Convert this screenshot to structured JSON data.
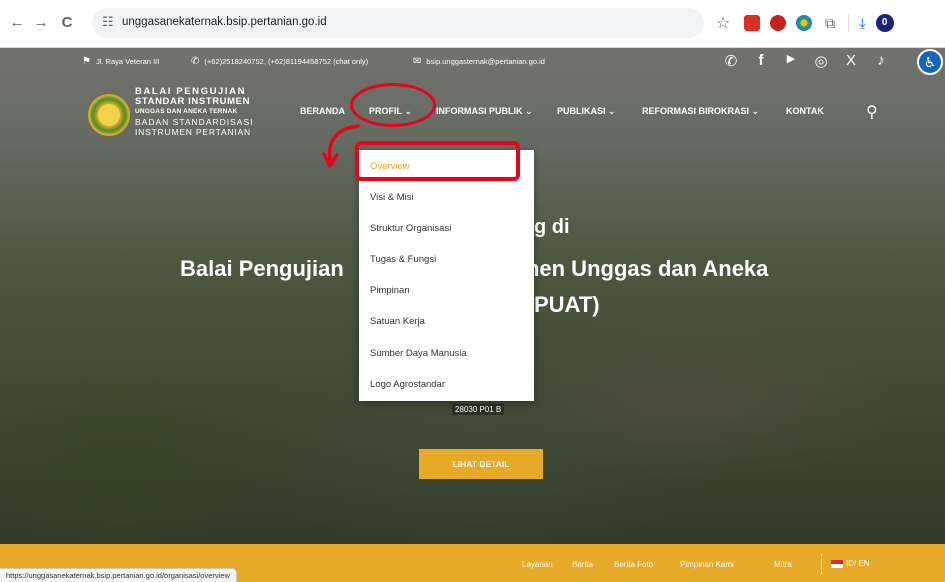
{
  "browser": {
    "url": "unggasanekaternak.bsip.pertanian.go.id",
    "back_icon": "←",
    "forward_icon": "→",
    "reload_icon": "C",
    "site_settings_icon": "☷",
    "star_icon": "☆",
    "puzzle_icon": "⧉",
    "download_icon": "⤓",
    "profile_initial": "0"
  },
  "topbar": {
    "address": "Jl. Raya Veteran III",
    "phone": "(+62)2518240752, (+62)81194458752 (chat only)",
    "email": "bsip.unggasternak@pertanian.go.id",
    "social_icons": [
      "whatsapp-icon",
      "facebook-icon",
      "youtube-icon",
      "instagram-icon",
      "x-icon",
      "tiktok-icon"
    ],
    "social_glyphs": [
      "✆",
      "f",
      "▶",
      "◎",
      "X",
      "♪"
    ]
  },
  "logo": {
    "line1": "BALAI PENGUJIAN",
    "line2": "STANDAR INSTRUMEN",
    "line3": "UNGGAS DAN ANEKA TERNAK",
    "line4": "BADAN STANDARDISASI",
    "line5": "INSTRUMEN PERTANIAN"
  },
  "nav": {
    "items": [
      {
        "label": "BERANDA"
      },
      {
        "label": "PROFIL ⌄"
      },
      {
        "label": "INFORMASI PUBLIK ⌄"
      },
      {
        "label": "PUBLIKASI ⌄"
      },
      {
        "label": "REFORMASI BIROKRASI ⌄"
      },
      {
        "label": "KONTAK"
      }
    ],
    "search_glyph": "⚲"
  },
  "profil_dropdown": {
    "items": [
      {
        "label": "Overview",
        "active": true
      },
      {
        "label": "Visi & Misi"
      },
      {
        "label": "Struktur Organisasi"
      },
      {
        "label": "Tugas & Fungsi"
      },
      {
        "label": "Pimpinan"
      },
      {
        "label": "Satuan Kerja"
      },
      {
        "label": "Sumber Daya Manusia"
      },
      {
        "label": "Logo Agrostandar"
      }
    ]
  },
  "hero": {
    "line1_visible": "g di",
    "line2_left": "Balai Pengujian",
    "line2_right": "men Unggas dan Aneka",
    "line3_visible": "PUAT)",
    "badge": "28030 P01 B",
    "cta_label": "LIHAT DETAIL"
  },
  "footer": {
    "links": [
      "Layanan",
      "Berita",
      "Berita Foto",
      "Pimpinan Kami",
      "Mitra"
    ],
    "lang_label": "ID/ EN",
    "accessibility_glyph": "♿"
  },
  "status_bar": {
    "url": "https://unggasanekaternak.bsip.pertanian.go.id/organisasi/overview"
  },
  "colors": {
    "accent": "#e7a928",
    "annotation": "#e4051a"
  }
}
